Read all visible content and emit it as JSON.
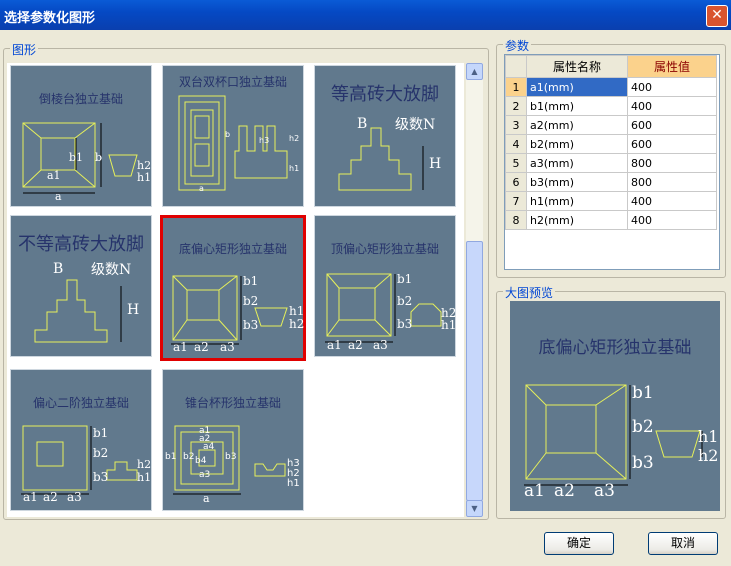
{
  "window": {
    "title": "选择参数化图形",
    "close_glyph": "✕"
  },
  "shapes_panel": {
    "label": "图形",
    "tiles": [
      {
        "title": "倒棱台独立基础",
        "labels": [
          "b",
          "b1",
          "a1",
          "a",
          "h2",
          "h1"
        ]
      },
      {
        "title": "双台双杯口独立基础",
        "labels": [
          "a",
          "b",
          "h2",
          "h1",
          "h3"
        ]
      },
      {
        "title": "等高砖大放脚",
        "labels": [
          "B",
          "级数N",
          "H"
        ]
      },
      {
        "title": "不等高砖大放脚",
        "labels": [
          "B",
          "级数N",
          "H"
        ]
      },
      {
        "title": "底偏心矩形独立基础",
        "labels": [
          "b1",
          "b2",
          "b3",
          "a1",
          "a2",
          "a3",
          "h1",
          "h2"
        ]
      },
      {
        "title": "顶偏心矩形独立基础",
        "labels": [
          "b1",
          "b2",
          "b3",
          "a1",
          "a2",
          "a3",
          "h2",
          "h1"
        ]
      },
      {
        "title": "偏心二阶独立基础",
        "labels": [
          "b1",
          "b2",
          "b3",
          "a1",
          "a2",
          "a3",
          "h2",
          "h1"
        ]
      },
      {
        "title": "锥台杯形独立基础",
        "labels": [
          "a1",
          "a2",
          "a3",
          "a4",
          "b1",
          "b2",
          "b3",
          "b4",
          "a",
          "h3",
          "h2",
          "h1"
        ]
      }
    ],
    "selected_tile": "底偏心矩形独立基础"
  },
  "params_panel": {
    "label": "参数",
    "columns": [
      "属性名称",
      "属性值"
    ],
    "rows": [
      {
        "num": "1",
        "name": "a1(mm)",
        "value": "400"
      },
      {
        "num": "2",
        "name": "b1(mm)",
        "value": "400"
      },
      {
        "num": "3",
        "name": "a2(mm)",
        "value": "600"
      },
      {
        "num": "4",
        "name": "b2(mm)",
        "value": "600"
      },
      {
        "num": "5",
        "name": "a3(mm)",
        "value": "800"
      },
      {
        "num": "6",
        "name": "b3(mm)",
        "value": "800"
      },
      {
        "num": "7",
        "name": "h1(mm)",
        "value": "400"
      },
      {
        "num": "8",
        "name": "h2(mm)",
        "value": "400"
      }
    ]
  },
  "preview_panel": {
    "label": "大图预览",
    "title": "底偏心矩形独立基础",
    "labels": [
      "b1",
      "b2",
      "b3",
      "a1",
      "a2",
      "a3",
      "h1",
      "h2"
    ]
  },
  "buttons": {
    "ok": "确定",
    "cancel": "取消"
  }
}
